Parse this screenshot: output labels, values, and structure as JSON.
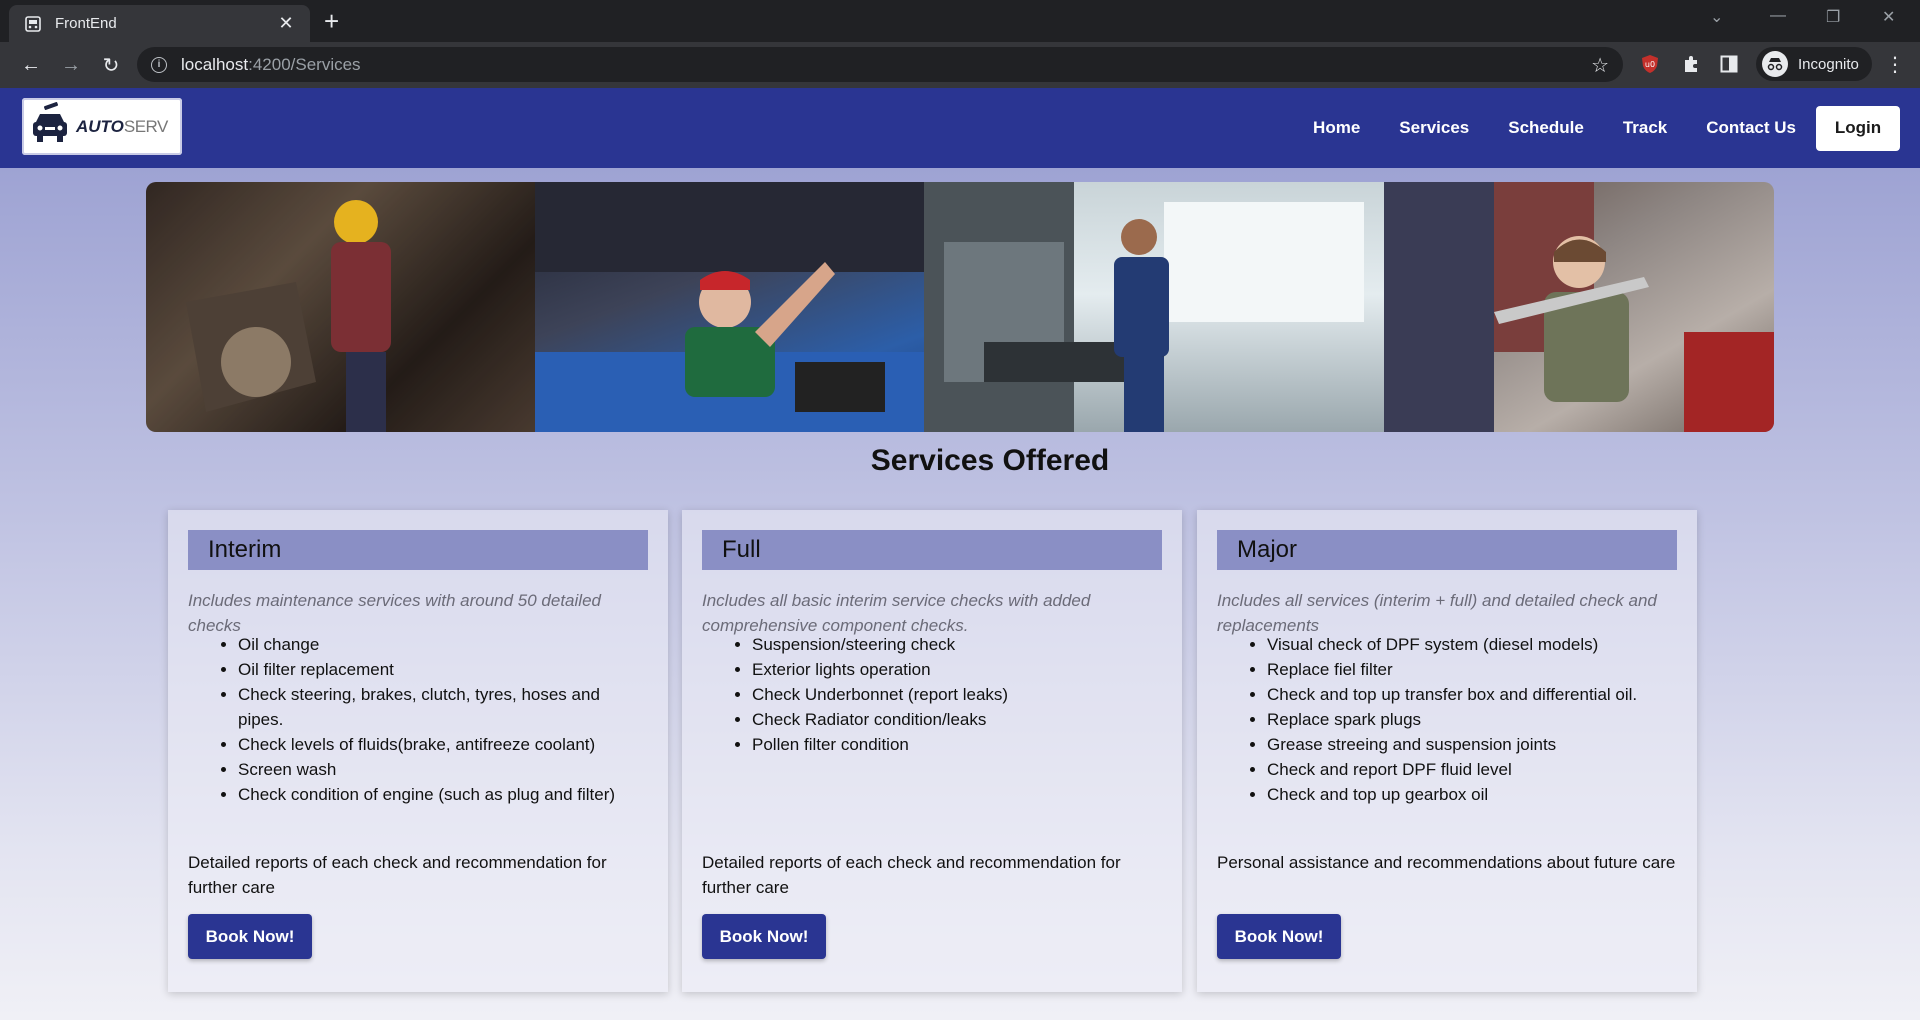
{
  "browser": {
    "tab_title": "FrontEnd",
    "url_host": "localhost",
    "url_path": ":4200/Services",
    "profile_label": "Incognito"
  },
  "header": {
    "logo_bold": "AUTO",
    "logo_light": "SERV",
    "nav": [
      "Home",
      "Services",
      "Schedule",
      "Track",
      "Contact Us"
    ],
    "login_label": "Login",
    "brand_color": "#2a3592"
  },
  "page": {
    "title": "Services Offered"
  },
  "services": [
    {
      "name": "Interim",
      "description": "Includes maintenance services with around 50 detailed checks",
      "items": [
        "Oil change",
        "Oil filter replacement",
        "Check steering, brakes, clutch, tyres, hoses and pipes.",
        "Check levels of fluids(brake, antifreeze coolant)",
        "Screen wash",
        "Check condition of engine (such as plug and filter)"
      ],
      "note": "Detailed reports of each check and recommendation for further care",
      "button": "Book Now!"
    },
    {
      "name": "Full",
      "description": "Includes all basic interim service checks with added comprehensive component checks.",
      "items": [
        "Suspension/steering check",
        "Exterior lights operation",
        "Check Underbonnet (report leaks)",
        "Check Radiator condition/leaks",
        "Pollen filter condition"
      ],
      "note": "Detailed reports of each check and recommendation for further care",
      "button": "Book Now!"
    },
    {
      "name": "Major",
      "description": "Includes all services (interim + full) and detailed check and replacements",
      "items": [
        "Visual check of DPF system (diesel models)",
        "Replace fiel filter",
        "Check and top up transfer box and differential oil.",
        "Replace spark plugs",
        "Grease streeing and suspension joints",
        "Check and report DPF fluid level",
        "Check and top up gearbox oil"
      ],
      "note": "Personal assistance and recommendations about future care",
      "button": "Book Now!"
    }
  ]
}
